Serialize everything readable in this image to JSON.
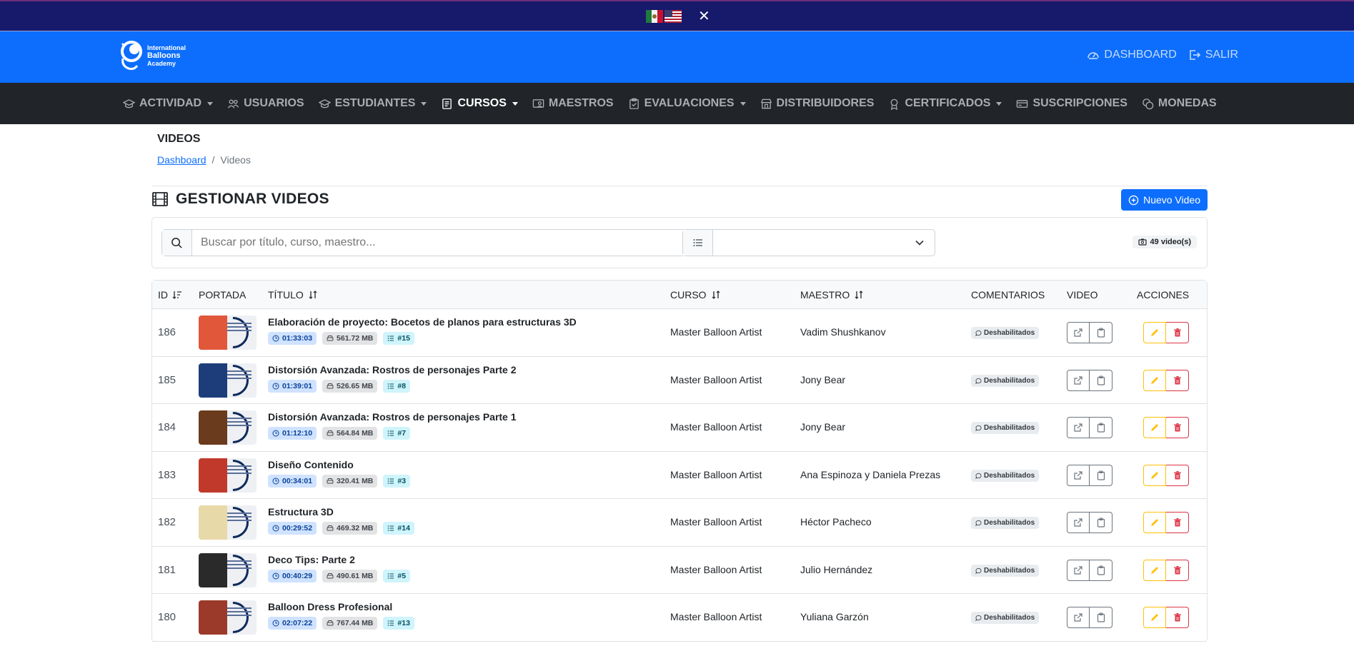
{
  "header": {
    "logo_line1": "International",
    "logo_line2": "Balloons",
    "logo_line3": "Academy",
    "dashboard_label": "DASHBOARD",
    "logout_label": "SALIR",
    "close_symbol": "✕"
  },
  "nav": {
    "items": [
      {
        "label": "ACTIVIDAD",
        "icon": "graduation-cap-icon",
        "dropdown": true
      },
      {
        "label": "USUARIOS",
        "icon": "people-icon",
        "dropdown": false
      },
      {
        "label": "ESTUDIANTES",
        "icon": "graduation-cap-icon",
        "dropdown": true
      },
      {
        "label": "CURSOS",
        "icon": "journal-icon",
        "dropdown": true,
        "active": true
      },
      {
        "label": "MAESTROS",
        "icon": "person-video-icon",
        "dropdown": false
      },
      {
        "label": "EVALUACIONES",
        "icon": "clipboard-check-icon",
        "dropdown": true
      },
      {
        "label": "DISTRIBUIDORES",
        "icon": "shop-icon",
        "dropdown": false
      },
      {
        "label": "CERTIFICADOS",
        "icon": "award-icon",
        "dropdown": true
      },
      {
        "label": "SUSCRIPCIONES",
        "icon": "credit-card-icon",
        "dropdown": false
      },
      {
        "label": "MONEDAS",
        "icon": "coins-icon",
        "dropdown": false
      }
    ]
  },
  "page": {
    "title": "VIDEOS",
    "breadcrumb_home": "Dashboard",
    "breadcrumb_sep": "/",
    "breadcrumb_current": "Videos",
    "section_title": "GESTIONAR VIDEOS",
    "new_button_label": "Nuevo Video"
  },
  "filters": {
    "search_placeholder": "Buscar por título, curso, maestro...",
    "select_value": "",
    "count_label": "49 video(s)"
  },
  "table": {
    "columns": {
      "id": "ID",
      "cover": "PORTADA",
      "title": "TÍTULO",
      "course": "CURSO",
      "teacher": "MAESTRO",
      "comments": "COMENTARIOS",
      "video": "VIDEO",
      "actions": "ACCIONES"
    },
    "rows": [
      {
        "id": "186",
        "title": "Elaboración de proyecto: Bocetos de planos para estructuras 3D",
        "duration": "01:33:03",
        "size": "561.72 MB",
        "number": "#15",
        "course": "Master Balloon Artist",
        "teacher": "Vadim Shushkanov",
        "comments": "Deshabilitados"
      },
      {
        "id": "185",
        "title": "Distorsión Avanzada: Rostros de personajes Parte 2",
        "duration": "01:39:01",
        "size": "526.65 MB",
        "number": "#8",
        "course": "Master Balloon Artist",
        "teacher": "Jony Bear",
        "comments": "Deshabilitados"
      },
      {
        "id": "184",
        "title": "Distorsión Avanzada: Rostros de personajes Parte 1",
        "duration": "01:12:10",
        "size": "564.84 MB",
        "number": "#7",
        "course": "Master Balloon Artist",
        "teacher": "Jony Bear",
        "comments": "Deshabilitados"
      },
      {
        "id": "183",
        "title": "Diseño Contenido",
        "duration": "00:34:01",
        "size": "320.41 MB",
        "number": "#3",
        "course": "Master Balloon Artist",
        "teacher": "Ana Espinoza y Daniela Prezas",
        "comments": "Deshabilitados"
      },
      {
        "id": "182",
        "title": "Estructura 3D",
        "duration": "00:29:52",
        "size": "469.32 MB",
        "number": "#14",
        "course": "Master Balloon Artist",
        "teacher": "Héctor Pacheco",
        "comments": "Deshabilitados"
      },
      {
        "id": "181",
        "title": "Deco Tips: Parte 2",
        "duration": "00:40:29",
        "size": "490.61 MB",
        "number": "#5",
        "course": "Master Balloon Artist",
        "teacher": "Julio Hernández",
        "comments": "Deshabilitados"
      },
      {
        "id": "180",
        "title": "Balloon Dress Profesional",
        "duration": "02:07:22",
        "size": "767.44 MB",
        "number": "#13",
        "course": "Master Balloon Artist",
        "teacher": "Yuliana Garzón",
        "comments": "Deshabilitados"
      }
    ]
  },
  "colors": {
    "top_bar": "#17196b",
    "header_blue": "#0d6efd",
    "nav_dark": "#212529",
    "edit_yellow": "#ffc107",
    "delete_red": "#dc3545"
  }
}
